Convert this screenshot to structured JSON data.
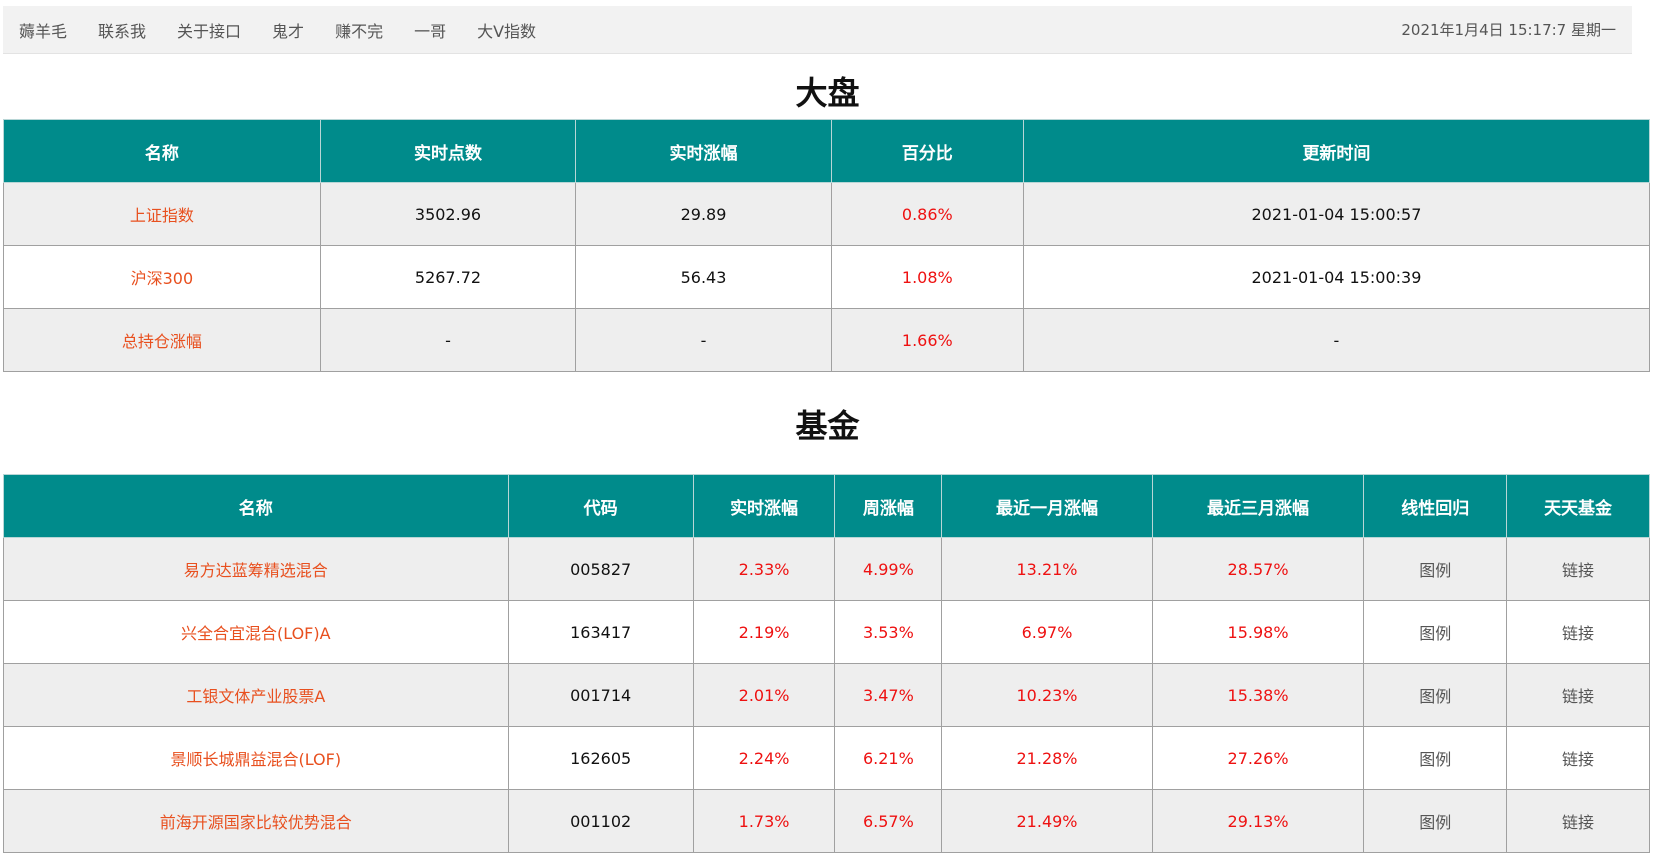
{
  "nav": {
    "items": [
      "薅羊毛",
      "联系我",
      "关于接口",
      "鬼才",
      "赚不完",
      "一哥",
      "大V指数"
    ],
    "datetime": "2021年1月4日 15:17:7 星期一"
  },
  "dapan": {
    "title": "大盘",
    "headers": [
      "名称",
      "实时点数",
      "实时涨幅",
      "百分比",
      "更新时间"
    ],
    "rows": [
      {
        "name": "上证指数",
        "points": "3502.96",
        "change": "29.89",
        "percent": "0.86%",
        "time": "2021-01-04 15:00:57"
      },
      {
        "name": "沪深300",
        "points": "5267.72",
        "change": "56.43",
        "percent": "1.08%",
        "time": "2021-01-04 15:00:39"
      },
      {
        "name": "总持仓涨幅",
        "points": "-",
        "change": "-",
        "percent": "1.66%",
        "time": "-"
      }
    ]
  },
  "jijin": {
    "title": "基金",
    "headers": [
      "名称",
      "代码",
      "实时涨幅",
      "周涨幅",
      "最近一月涨幅",
      "最近三月涨幅",
      "线性回归",
      "天天基金"
    ],
    "rows": [
      {
        "name": "易方达蓝筹精选混合",
        "code": "005827",
        "rt": "2.33%",
        "week": "4.99%",
        "m1": "13.21%",
        "m3": "28.57%",
        "chart": "图例",
        "link": "链接"
      },
      {
        "name": "兴全合宜混合(LOF)A",
        "code": "163417",
        "rt": "2.19%",
        "week": "3.53%",
        "m1": "6.97%",
        "m3": "15.98%",
        "chart": "图例",
        "link": "链接"
      },
      {
        "name": "工银文体产业股票A",
        "code": "001714",
        "rt": "2.01%",
        "week": "3.47%",
        "m1": "10.23%",
        "m3": "15.38%",
        "chart": "图例",
        "link": "链接"
      },
      {
        "name": "景顺长城鼎益混合(LOF)",
        "code": "162605",
        "rt": "2.24%",
        "week": "6.21%",
        "m1": "21.28%",
        "m3": "27.26%",
        "chart": "图例",
        "link": "链接"
      },
      {
        "name": "前海开源国家比较优势混合",
        "code": "001102",
        "rt": "1.73%",
        "week": "6.57%",
        "m1": "21.49%",
        "m3": "29.13%",
        "chart": "图例",
        "link": "链接"
      }
    ]
  }
}
